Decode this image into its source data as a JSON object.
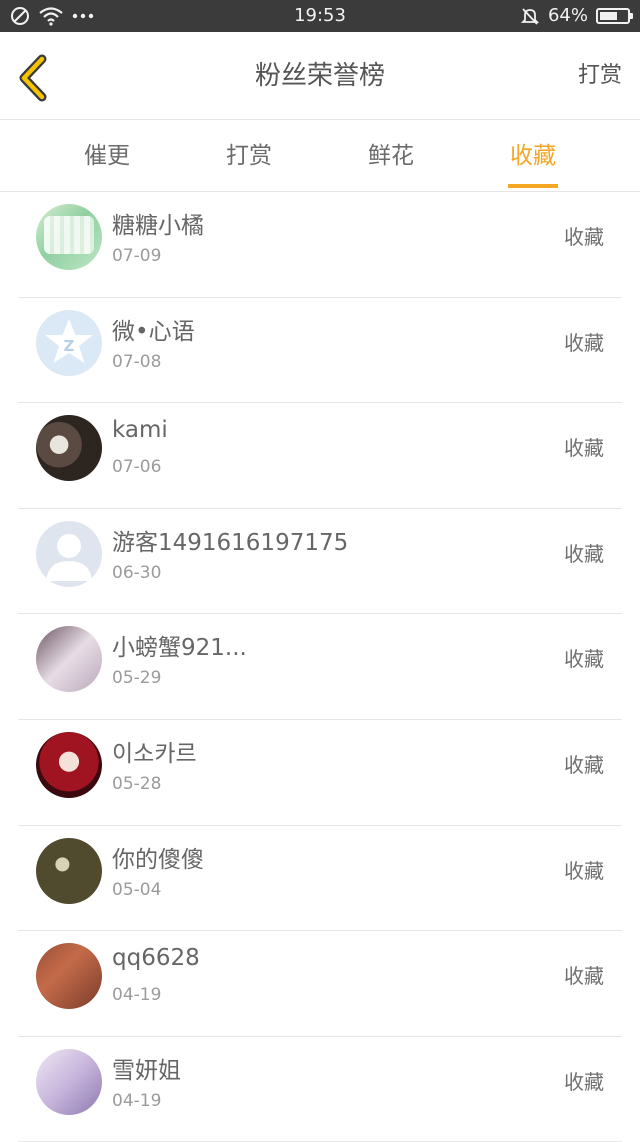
{
  "status_bar": {
    "time": "19:53",
    "battery_text": "64%",
    "battery_level": 0.64,
    "icons_left": [
      "blocked-icon",
      "wifi-icon",
      "more-dots-icon"
    ],
    "icons_right": [
      "mute-bell-icon",
      "battery-icon"
    ]
  },
  "nav": {
    "back_icon": "chevron-left-icon",
    "title": "粉丝荣誉榜",
    "action_label": "打赏",
    "accent_color": "#f5a623"
  },
  "tabs": [
    {
      "label": "催更",
      "active": false
    },
    {
      "label": "打赏",
      "active": false
    },
    {
      "label": "鲜花",
      "active": false
    },
    {
      "label": "收藏",
      "active": true
    }
  ],
  "rows": [
    {
      "name": "糖糖小橘",
      "date": "07-09",
      "action": "收藏"
    },
    {
      "name": "微•心语",
      "date": "07-08",
      "action": "收藏"
    },
    {
      "name": "kami",
      "date": "07-06",
      "action": "收藏"
    },
    {
      "name": "游客1491616197175",
      "date": "06-30",
      "action": "收藏"
    },
    {
      "name": "小螃蟹921...",
      "date": "05-29",
      "action": "收藏"
    },
    {
      "name": "이소카르",
      "date": "05-28",
      "action": "收藏"
    },
    {
      "name": "你的傻傻",
      "date": "05-04",
      "action": "收藏"
    },
    {
      "name": "qq6628",
      "date": "04-19",
      "action": "收藏"
    },
    {
      "name": "雪妍姐",
      "date": "04-19",
      "action": "收藏"
    }
  ]
}
